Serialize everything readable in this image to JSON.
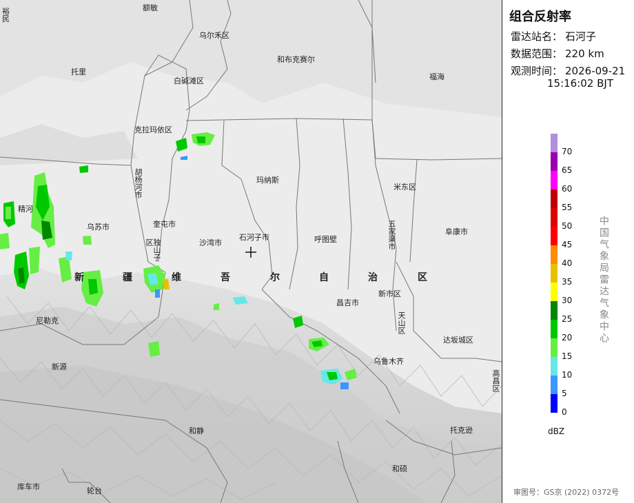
{
  "panel": {
    "title": "组合反射率",
    "station_key": "雷达站名：",
    "station_val": "石河子",
    "range_key": "数据范围：",
    "range_val": "220 km",
    "time_key": "观测时间：",
    "time_val_1": "2026-09-21",
    "time_val_2": "15:16:02 BJT",
    "org": "中国气象局雷达气象中心",
    "approval": "审图号：GS京 (2022) 0372号"
  },
  "legend": {
    "unit": "dBZ",
    "labels": [
      "70",
      "65",
      "60",
      "55",
      "50",
      "45",
      "40",
      "35",
      "30",
      "25",
      "20",
      "15",
      "10",
      "5",
      "0"
    ],
    "colors": [
      "#b08ee0",
      "#9a00b0",
      "#ff00ff",
      "#c00000",
      "#e00000",
      "#ff0000",
      "#ff8c00",
      "#e8c000",
      "#ffff00",
      "#008800",
      "#00c800",
      "#66ee44",
      "#66e8e8",
      "#3c96ff",
      "#0000ff"
    ]
  },
  "map": {
    "places": [
      {
        "id": "yumin",
        "name": "裕民"
      },
      {
        "id": "emin",
        "name": "额敏"
      },
      {
        "id": "wuerhe",
        "name": "乌尔禾区"
      },
      {
        "id": "tuoli",
        "name": "托里"
      },
      {
        "id": "hebukesaier",
        "name": "和布克赛尔"
      },
      {
        "id": "fuhai",
        "name": "福海"
      },
      {
        "id": "baijiantan",
        "name": "白碱滩区"
      },
      {
        "id": "kelamayi",
        "name": "克拉玛依区"
      },
      {
        "id": "manasi",
        "name": "玛纳斯"
      },
      {
        "id": "midong",
        "name": "米东区"
      },
      {
        "id": "jinghe",
        "name": "精河"
      },
      {
        "id": "wusu",
        "name": "乌苏市"
      },
      {
        "id": "kuitun",
        "name": "奎屯市"
      },
      {
        "id": "shawan",
        "name": "沙湾市"
      },
      {
        "id": "shihezi",
        "name": "石河子市"
      },
      {
        "id": "hutubi",
        "name": "呼图壁"
      },
      {
        "id": "fukang",
        "name": "阜康市"
      },
      {
        "id": "changji",
        "name": "昌吉市"
      },
      {
        "id": "xinshi",
        "name": "新市区"
      },
      {
        "id": "nileke",
        "name": "尼勒克"
      },
      {
        "id": "dabancheng",
        "name": "达坂城区"
      },
      {
        "id": "wulumuqi",
        "name": "乌鲁木齐"
      },
      {
        "id": "xinyuan",
        "name": "新源"
      },
      {
        "id": "hejing",
        "name": "和静"
      },
      {
        "id": "tuokexun",
        "name": "托克逊"
      },
      {
        "id": "heshuo",
        "name": "和硕"
      },
      {
        "id": "kuche",
        "name": "库车市"
      },
      {
        "id": "luntai",
        "name": "轮台"
      }
    ],
    "vplaces": [
      {
        "id": "huyanghe",
        "name": "胡杨河市"
      },
      {
        "id": "dushanzi",
        "name": "独山子区"
      },
      {
        "id": "wujiaqu",
        "name": "五家渠市"
      },
      {
        "id": "tianshan",
        "name": "天山区"
      },
      {
        "id": "gaochang",
        "name": "高昌区"
      }
    ],
    "region_chars": [
      "新",
      "疆",
      "维",
      "吾",
      "尔",
      "自",
      "治",
      "区"
    ]
  }
}
